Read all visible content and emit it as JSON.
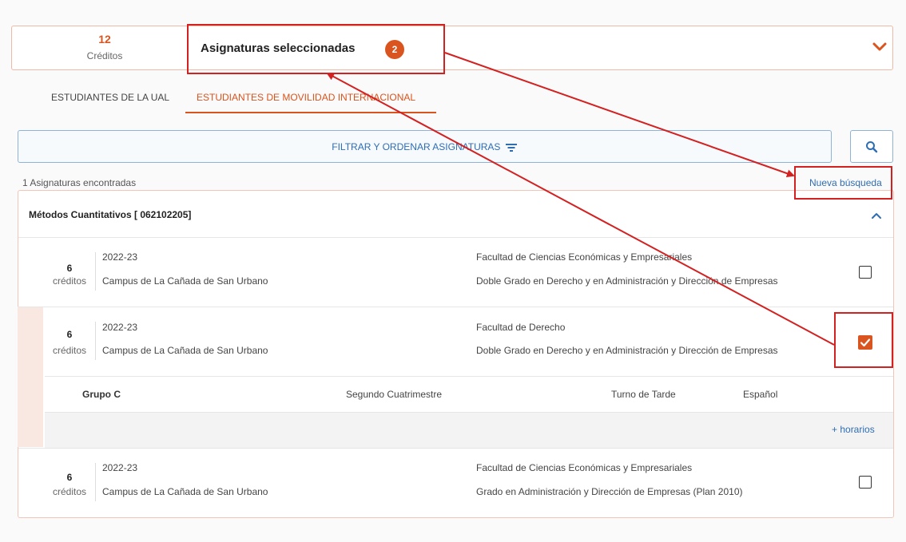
{
  "header": {
    "credits_value": "12",
    "credits_label": "Créditos",
    "selected_title": "Asignaturas seleccionadas",
    "selected_count": "2"
  },
  "tabs": [
    {
      "label": "ESTUDIANTES DE LA UAL",
      "active": false
    },
    {
      "label": "ESTUDIANTES DE MOVILIDAD INTERNACIONAL",
      "active": true
    }
  ],
  "filter": {
    "label": "FILTRAR Y ORDENAR ASIGNATURAS"
  },
  "results": {
    "found_text": "1 Asignaturas encontradas",
    "new_search_label": "Nueva búsqueda",
    "subject_title": "Métodos Cuantitativos [ 062102205]",
    "rows": [
      {
        "credits": "6",
        "credits_label": "créditos",
        "year": "2022-23",
        "campus": "Campus de La Cañada de San Urbano",
        "faculty": "Facultad de Ciencias Económicas y Empresariales",
        "degree": "Doble Grado en Derecho y en Administración y Dirección de Empresas",
        "checked": false
      },
      {
        "credits": "6",
        "credits_label": "créditos",
        "year": "2022-23",
        "campus": "Campus de La Cañada de San Urbano",
        "faculty": "Facultad de Derecho",
        "degree": "Doble Grado en Derecho y en Administración y Dirección de Empresas",
        "checked": true,
        "group": "Grupo C",
        "semester": "Segundo Cuatrimestre",
        "shift": "Turno de Tarde",
        "language": "Español",
        "schedules_label": "+ horarios"
      },
      {
        "credits": "6",
        "credits_label": "créditos",
        "year": "2022-23",
        "campus": "Campus de La Cañada de San Urbano",
        "faculty": "Facultad de Ciencias Económicas y Empresariales",
        "degree": "Grado en Administración y Dirección de Empresas (Plan 2010)",
        "checked": false
      }
    ]
  },
  "colors": {
    "accent": "#d9541e",
    "link": "#2f6db3",
    "annotation": "#d32121"
  }
}
